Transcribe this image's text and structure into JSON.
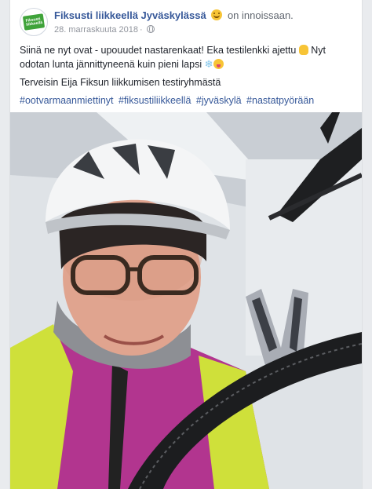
{
  "post": {
    "page_name": "Fiksusti liikkeellä Jyväskylässä",
    "feeling_text": "on innoissaan.",
    "date": "28. marraskuuta 2018",
    "separator": "·",
    "avatar_label": "Fiksusti liikkeellä",
    "paragraph_1_a": "Siinä ne nyt ovat - upouudet nastarenkaat! Eka testilenkki ajettu",
    "paragraph_1_b": "Nyt odotan lunta jännittyneenä kuin pieni lapsi",
    "paragraph_2": "Terveisin Eija Fiksun liikkumisen testiryhmästä",
    "hashtags": [
      "#ootvarmaanmiettinyt",
      "#fiksustiliikkeellä",
      "#jyväskylä",
      "#nastatpyörään"
    ]
  },
  "icons": {
    "feeling": "smiling-face-icon",
    "privacy": "globe-icon",
    "ok_hand": "ok-hand-icon",
    "snowflake": "snowflake-icon",
    "tongue": "tongue-face-icon"
  },
  "colors": {
    "link": "#365899",
    "text": "#1d2129",
    "meta": "#90949c",
    "brand_green": "#3fa33a"
  }
}
